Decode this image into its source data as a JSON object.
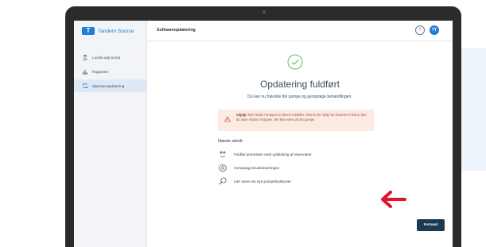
{
  "app": {
    "logo_text": "Tandem Source",
    "logo_mark": "T"
  },
  "sidebar": {
    "items": [
      {
        "label": "Lucida upp pump",
        "icon": "upload-icon"
      },
      {
        "label": "Rapporter",
        "icon": "bar-chart-icon"
      },
      {
        "label": "Mjukvaruopdatering",
        "icon": "refresh-icon",
        "active": true
      }
    ]
  },
  "header": {
    "title": "Softwareopdatering",
    "help": "?",
    "avatar_initials": "TT"
  },
  "main": {
    "title": "Opdatering fuldført",
    "subtitle": "Du kan nu frakoble din pumpe og genoptage behandlingen.",
    "warning": {
      "bold": "Vigtigt:",
      "text": " Din insulin i kroppen er blevet nulstillet. Hvis du for nylig har doseret en bolus, kan du have insulin i kroppen, der ikke vises på din pumpe."
    },
    "next_steps_heading": "Næste skridt",
    "steps": [
      {
        "label": "Fuldfør processen med opfyldning af reservoiret",
        "icon": "fill-icon"
      },
      {
        "label": "Genoptag insulindoseringen",
        "icon": "droplet-icon"
      },
      {
        "label": "Lær mere om nye pumpefunktioner",
        "icon": "magnifier-icon"
      }
    ],
    "continue_label": "Fortsæt"
  },
  "colors": {
    "brand": "#1d7fd6",
    "success": "#5cb85c",
    "warning_bg": "#fcebe2",
    "button": "#1b3a52",
    "arrow": "#e0142b"
  }
}
